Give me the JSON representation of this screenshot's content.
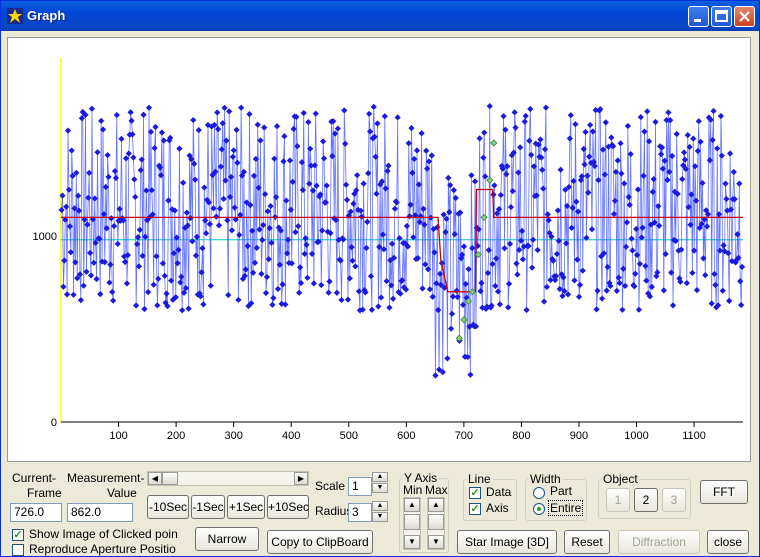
{
  "window": {
    "title": "Graph"
  },
  "chart_data": {
    "type": "scatter",
    "x_ticks": [
      "100",
      "200",
      "300",
      "400",
      "500",
      "600",
      "700",
      "800",
      "900",
      "1000",
      "1100"
    ],
    "y_ticks": [
      "0",
      "1000"
    ],
    "xlim": [
      0,
      1185
    ],
    "ylim": [
      0,
      2000
    ],
    "series": [
      {
        "values": [
          {
            "x": 5,
            "y": 470
          },
          {
            "x": 50,
            "y": 1300
          },
          {
            "x": 100,
            "y": 1150
          },
          {
            "x": 150,
            "y": 1200
          },
          {
            "x": 200,
            "y": 1000
          },
          {
            "x": 250,
            "y": 1250
          },
          {
            "x": 300,
            "y": 1100
          },
          {
            "x": 350,
            "y": 1200
          },
          {
            "x": 400,
            "y": 1300
          },
          {
            "x": 450,
            "y": 1050
          },
          {
            "x": 500,
            "y": 1400
          },
          {
            "x": 550,
            "y": 1100
          },
          {
            "x": 600,
            "y": 1300
          },
          {
            "x": 650,
            "y": 900
          },
          {
            "x": 680,
            "y": 500
          },
          {
            "x": 700,
            "y": 700
          },
          {
            "x": 720,
            "y": 800
          },
          {
            "x": 750,
            "y": 1100
          },
          {
            "x": 800,
            "y": 1350
          },
          {
            "x": 850,
            "y": 1200
          },
          {
            "x": 900,
            "y": 1300
          },
          {
            "x": 950,
            "y": 1100
          },
          {
            "x": 1000,
            "y": 1250
          },
          {
            "x": 1050,
            "y": 1200
          },
          {
            "x": 1100,
            "y": 1300
          },
          {
            "x": 1150,
            "y": 1150
          },
          {
            "x": 1180,
            "y": 1250
          }
        ]
      },
      {
        "values": [
          {
            "x": 692,
            "y": 450
          },
          {
            "x": 700,
            "y": 550
          },
          {
            "x": 708,
            "y": 650
          },
          {
            "x": 715,
            "y": 700
          },
          {
            "x": 725,
            "y": 900
          },
          {
            "x": 735,
            "y": 1100
          },
          {
            "x": 745,
            "y": 1300
          },
          {
            "x": 752,
            "y": 1500
          }
        ]
      }
    ],
    "lines": [
      {
        "color": "#cc0000",
        "points": [
          {
            "x": 0,
            "y": 1100
          },
          {
            "x": 655,
            "y": 1100
          },
          {
            "x": 660,
            "y": 870
          },
          {
            "x": 672,
            "y": 700
          },
          {
            "x": 720,
            "y": 700
          },
          {
            "x": 722,
            "y": 1250
          },
          {
            "x": 750,
            "y": 1250
          },
          {
            "x": 752,
            "y": 1100
          },
          {
            "x": 1185,
            "y": 1100
          }
        ]
      },
      {
        "color": "#00c8c8",
        "points": [
          {
            "x": 0,
            "y": 980
          },
          {
            "x": 1185,
            "y": 980
          }
        ]
      }
    ],
    "dense_count": 1185
  },
  "controls": {
    "current_frame_label_1": "Current-",
    "current_frame_label_2": "Frame",
    "current_frame_value": "726.0",
    "measurement_label_1": "Measurement-",
    "measurement_label_2": "Value",
    "measurement_value": "862.0",
    "btn_m10": "-10Sec",
    "btn_m1": "-1Sec",
    "btn_p1": "+1Sec",
    "btn_p10": "+10Sec",
    "scale_label": "Scale",
    "scale_value": "1",
    "radius_label": "Radius",
    "radius_value": "3",
    "yaxis_label": "Y Axis",
    "min_label": "Min",
    "max_label": "Max",
    "line_group": "Line",
    "data_chk": "Data",
    "axis_chk": "Axis",
    "width_group": "Width",
    "part_radio": "Part",
    "entire_radio": "Entire",
    "object_group": "Object",
    "obj1": "1",
    "obj2": "2",
    "obj3": "3",
    "fft": "FFT",
    "show_image_chk": "Show Image of Clicked poin",
    "reproduce_chk": "Reproduce Aperture Positio",
    "narrow": "Narrow",
    "copy": "Copy to ClipBoard",
    "star_image": "Star Image [3D]",
    "reset": "Reset",
    "diffraction": "Diffraction",
    "close": "close"
  }
}
